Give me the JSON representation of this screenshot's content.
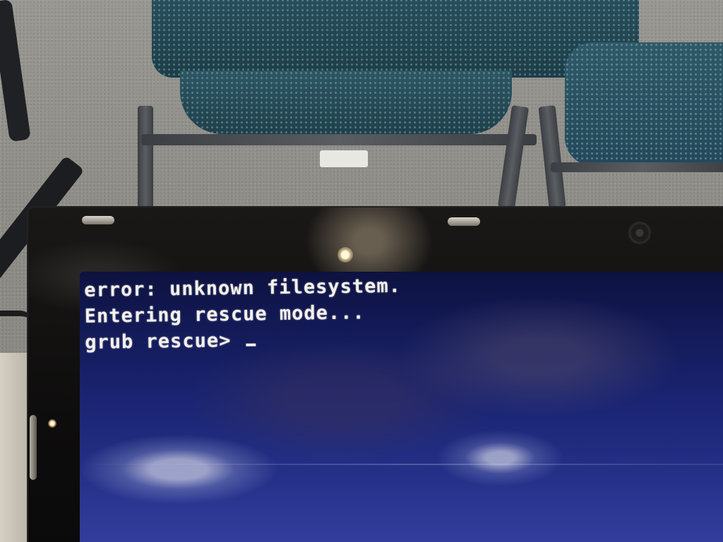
{
  "screen": {
    "background_color": "#1a2472",
    "text_color": "#f4f1ea",
    "lines": [
      "error: unknown filesystem.",
      "Entering rescue mode...",
      "grub rescue> "
    ],
    "cursor": "_"
  },
  "scene": {
    "chair_color": "#294f5c",
    "bezel_color": "#0e0d0d",
    "carpet_color": "#8f8e88"
  }
}
